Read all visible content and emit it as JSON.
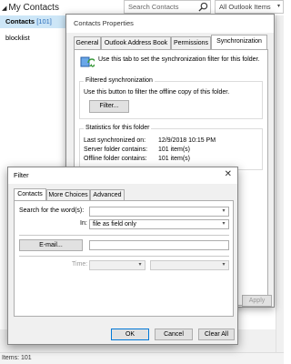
{
  "header": {
    "folder_title": "My Contacts",
    "search_placeholder": "Search Contacts",
    "scope": "All Outlook Items"
  },
  "sidebar": {
    "selected_label": "Contacts",
    "selected_count": "[101]",
    "items": [
      "blocklist"
    ]
  },
  "status_bar": {
    "text": "Items: 101"
  },
  "contacts_properties": {
    "title": "Contacts Properties",
    "tabs": [
      "General",
      "Outlook Address Book",
      "Permissions",
      "Synchronization"
    ],
    "active_tab": "Synchronization",
    "intro": "Use this tab to set the synchronization filter for this folder.",
    "filtered_sync": {
      "heading": "Filtered synchronization",
      "description": "Use this button to filter the offline copy of this folder.",
      "button": "Filter..."
    },
    "stats": {
      "heading": "Statistics for this folder",
      "rows": [
        {
          "label": "Last synchronized on:",
          "value": "12/9/2018 10:15 PM"
        },
        {
          "label": "Server folder contains:",
          "value": "101 item(s)"
        },
        {
          "label": "Offline folder contains:",
          "value": "101 item(s)"
        }
      ]
    },
    "apply_button": "Apply"
  },
  "filter_dialog": {
    "title": "Filter",
    "tabs": [
      "Contacts",
      "More Choices",
      "Advanced"
    ],
    "active_tab": "Contacts",
    "search_label": "Search for the word(s):",
    "search_value": "",
    "in_label": "In:",
    "in_value": "file as field only",
    "email_button": "E-mail...",
    "email_value": "",
    "time_label": "Time:",
    "buttons": {
      "ok": "OK",
      "cancel": "Cancel",
      "clear_all": "Clear All"
    }
  }
}
